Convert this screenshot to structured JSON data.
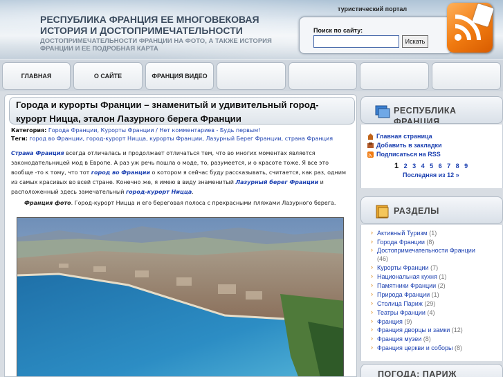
{
  "header": {
    "title": "РЕСПУБЛИКА ФРАНЦИЯ ЕЕ МНОГОВЕКОВАЯ ИСТОРИЯ И ДОСТОПРИМЕЧАТЕЛЬНОСТИ",
    "description": "ДОСТОПРИМЕЧАТЕЛЬНОСТИ ФРАНЦИИ НА ФОТО, А ТАКЖЕ ИСТОРИЯ ФРАНЦИИ И ЕЕ ПОДРОБНАЯ КАРТА",
    "portal_label": "туристический портал",
    "search_label": "Поиск по сайту:",
    "search_value": "",
    "search_button": "Искать",
    "rss_icon": "rss-feed-icon",
    "rss_color": "#f07a10"
  },
  "nav": {
    "items": [
      "ГЛАВНАЯ",
      "О САЙТЕ",
      "ФРАНЦИЯ ВИДЕО",
      "",
      "",
      "",
      ""
    ]
  },
  "post": {
    "title": "Города и курорты Франции – знаменитый и удивительный город-курорт Ницца, эталон Лазурного берега Франции",
    "category_label": "Категория:",
    "categories": "Города Франции, Курорты Франции / Нет комментариев - Будь первым!",
    "tags_label": "Теги:",
    "tags": "город во Франции, город-курорт Ницца, курорты Франции, Лазурный Берег Франции, страна Франция",
    "p1_tag": "Страна Франция",
    "p1_a": " всегда отличалась и продолжает отличаться тем, что во многих моментах является законодательницей мод в Европе. А раз уж речь пошла о моде, то, разумеется, и о красоте тоже. Я все это вообще -то к тому, что тот ",
    "p1_tag2": "город во Франции",
    "p1_b": " о котором я сейчас буду рассказывать, считается, как раз, одним из самых красивых во всей стране. Конечно же, я имею в виду знаменитый ",
    "p1_tag3": "Лазурный берег Франции",
    "p1_c": " и расположенный здесь замечательный ",
    "p1_tag4": "город-курорт Ницца",
    "p1_end": ".",
    "caption_bold": "Франция фото",
    "caption_rest": ". Город-курорт Ницца и его береговая полоса с прекрасными пляжами Лазурного берега."
  },
  "sidebar": {
    "republic_title": "РЕСПУБЛИКА ФРАНЦИЯ",
    "links": [
      "Главная страница",
      "Добавить в закладки",
      "Подписаться на RSS"
    ],
    "pager_current": "1",
    "pager_pages": "2 3 4 5 6 7 8 9",
    "pager_last": "Последняя из 12 »",
    "sections_title": "РАЗДЕЛЫ",
    "categories": [
      {
        "name": "Активный Туризм",
        "count": "(1)"
      },
      {
        "name": "Города Франции",
        "count": "(8)"
      },
      {
        "name": "Достопримечательности Франции",
        "count": ""
      },
      {
        "name": "",
        "count": "(46)"
      },
      {
        "name": "Курорты Франции",
        "count": "(7)"
      },
      {
        "name": "Национальная кухня",
        "count": "(1)"
      },
      {
        "name": "Памятники Франции",
        "count": "(2)"
      },
      {
        "name": "Природа Франции",
        "count": "(1)"
      },
      {
        "name": "Столица Париж",
        "count": "(29)"
      },
      {
        "name": "Театры Франции",
        "count": "(4)"
      },
      {
        "name": "Франция",
        "count": "(9)"
      },
      {
        "name": "Франция дворцы и замки",
        "count": "(12)"
      },
      {
        "name": "Франция музеи",
        "count": "(8)"
      },
      {
        "name": "Франция церкви и соборы",
        "count": "(8)"
      }
    ],
    "weather_title": "ПОГОДА: ПАРИЖ"
  }
}
